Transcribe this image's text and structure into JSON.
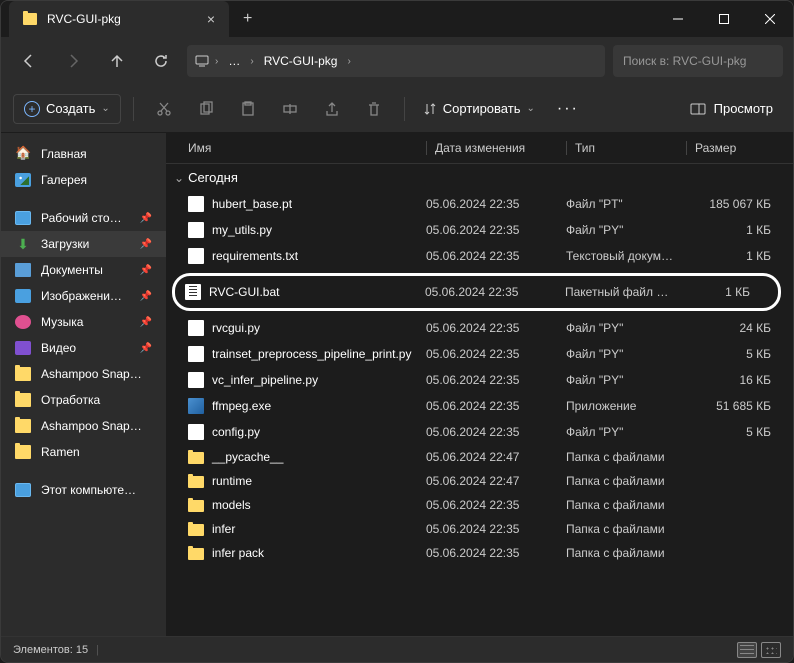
{
  "tab": {
    "title": "RVC-GUI-pkg",
    "close": "×"
  },
  "nav": {
    "breadcrumb": {
      "dots": "…",
      "folder": "RVC-GUI-pkg"
    },
    "search_placeholder": "Поиск в: RVC-GUI-pkg"
  },
  "toolbar": {
    "create": "Создать",
    "sort": "Сортировать",
    "view": "Просмотр"
  },
  "sidebar": {
    "home": "Главная",
    "gallery": "Галерея",
    "desktop": "Рабочий сто…",
    "downloads": "Загрузки",
    "documents": "Документы",
    "images": "Изображени…",
    "music": "Музыка",
    "video": "Видео",
    "ashampoo1": "Ashampoo Snap…",
    "otrabotka": "Отработка",
    "ashampoo2": "Ashampoo Snap…",
    "ramen": "Ramen",
    "thispc": "Этот компьюте…"
  },
  "columns": {
    "name": "Имя",
    "date": "Дата изменения",
    "type": "Тип",
    "size": "Размер"
  },
  "group": "Сегодня",
  "files": [
    {
      "name": "hubert_base.pt",
      "date": "05.06.2024 22:35",
      "type": "Файл \"PT\"",
      "size": "185 067 КБ",
      "icon": "file"
    },
    {
      "name": "my_utils.py",
      "date": "05.06.2024 22:35",
      "type": "Файл \"PY\"",
      "size": "1 КБ",
      "icon": "file"
    },
    {
      "name": "requirements.txt",
      "date": "05.06.2024 22:35",
      "type": "Текстовый докум…",
      "size": "1 КБ",
      "icon": "file"
    },
    {
      "name": "RVC-GUI.bat",
      "date": "05.06.2024 22:35",
      "type": "Пакетный файл …",
      "size": "1 КБ",
      "icon": "bat",
      "highlighted": true
    },
    {
      "name": "rvcgui.py",
      "date": "05.06.2024 22:35",
      "type": "Файл \"PY\"",
      "size": "24 КБ",
      "icon": "file"
    },
    {
      "name": "trainset_preprocess_pipeline_print.py",
      "date": "05.06.2024 22:35",
      "type": "Файл \"PY\"",
      "size": "5 КБ",
      "icon": "file"
    },
    {
      "name": "vc_infer_pipeline.py",
      "date": "05.06.2024 22:35",
      "type": "Файл \"PY\"",
      "size": "16 КБ",
      "icon": "file"
    },
    {
      "name": "ffmpeg.exe",
      "date": "05.06.2024 22:35",
      "type": "Приложение",
      "size": "51 685 КБ",
      "icon": "exe"
    },
    {
      "name": "config.py",
      "date": "05.06.2024 22:35",
      "type": "Файл \"PY\"",
      "size": "5 КБ",
      "icon": "file"
    },
    {
      "name": "__pycache__",
      "date": "05.06.2024 22:47",
      "type": "Папка с файлами",
      "size": "",
      "icon": "folder"
    },
    {
      "name": "runtime",
      "date": "05.06.2024 22:47",
      "type": "Папка с файлами",
      "size": "",
      "icon": "folder"
    },
    {
      "name": "models",
      "date": "05.06.2024 22:35",
      "type": "Папка с файлами",
      "size": "",
      "icon": "folder"
    },
    {
      "name": "infer",
      "date": "05.06.2024 22:35",
      "type": "Папка с файлами",
      "size": "",
      "icon": "folder"
    },
    {
      "name": "infer pack",
      "date": "05.06.2024 22:35",
      "type": "Папка с файлами",
      "size": "",
      "icon": "folder"
    }
  ],
  "status": {
    "count": "Элементов: 15"
  }
}
